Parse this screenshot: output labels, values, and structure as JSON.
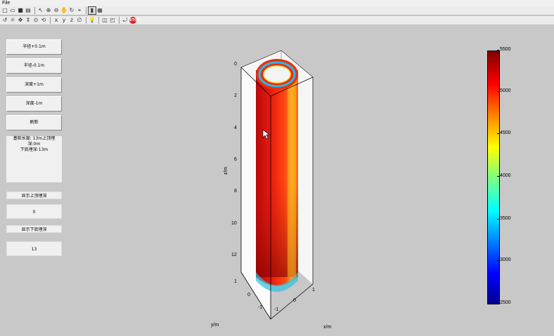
{
  "menu": {
    "file": "File"
  },
  "controls": {
    "radius_plus": "半径+0.1m",
    "radius_minus": "半径-0.1m",
    "depth_plus": "深度+1m",
    "depth_minus": "深度-1m",
    "refresh": "刷新",
    "info_line1": "基桩长度: 13m上顶埋深:0m",
    "info_line2": "下底埋深:13m",
    "top_label": "显示上顶埋深",
    "top_value": "0",
    "bottom_label": "显示下底埋深",
    "bottom_value": "13"
  },
  "plot": {
    "z_label": "z/m",
    "x_label": "x/m",
    "y_label": "y/m",
    "z_ticks": [
      "0",
      "2",
      "4",
      "6",
      "8",
      "10",
      "12"
    ],
    "y_ticks": [
      "1",
      "0",
      "-1"
    ],
    "x_ticks": [
      "-1",
      "0",
      "1"
    ],
    "colorbar_ticks": [
      "5500",
      "5000",
      "4500",
      "4000",
      "3500",
      "3000",
      "2500"
    ],
    "colormap": [
      "#00008f",
      "#0000ff",
      "#00ffff",
      "#ffff00",
      "#ff7f00",
      "#ff0000",
      "#800000"
    ]
  }
}
